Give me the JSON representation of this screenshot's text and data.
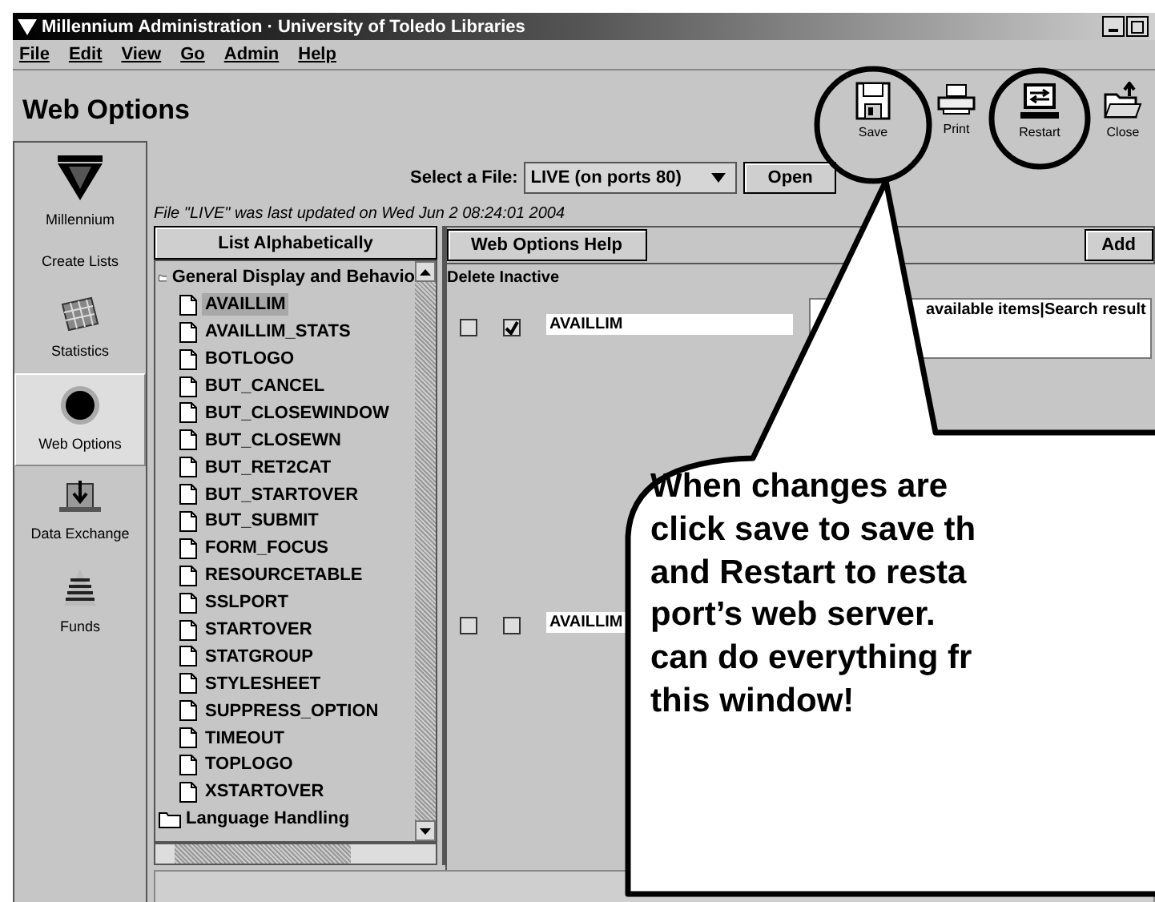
{
  "window": {
    "title": "Millennium Administration · University of Toledo Libraries"
  },
  "menu": [
    "File",
    "Edit",
    "View",
    "Go",
    "Admin",
    "Help"
  ],
  "page_title": "Web Options",
  "toolbar": [
    {
      "kind": "save",
      "label": "Save"
    },
    {
      "kind": "print",
      "label": "Print"
    },
    {
      "kind": "restart",
      "label": "Restart"
    },
    {
      "kind": "close",
      "label": "Close"
    }
  ],
  "sidebar": [
    {
      "kind": "logo",
      "label": "Millennium",
      "selected": false
    },
    {
      "kind": "none",
      "label": "Create Lists",
      "selected": false
    },
    {
      "kind": "statistics",
      "label": "Statistics",
      "selected": false
    },
    {
      "kind": "web_options",
      "label": "Web Options",
      "selected": true
    },
    {
      "kind": "data_exchange",
      "label": "Data Exchange",
      "selected": false
    },
    {
      "kind": "funds",
      "label": "Funds",
      "selected": false
    }
  ],
  "file_select": {
    "label": "Select a File:",
    "value": "LIVE (on ports 80)",
    "button": "Open"
  },
  "info": "File \"LIVE\" was last updated on Wed Jun  2 08:24:01 2004",
  "list_button": "List Alphabetically",
  "tree": [
    {
      "label": "General Display and Behavio",
      "children": [
        {
          "label": "AVAILLIM",
          "selected": true
        },
        {
          "label": "AVAILLIM_STATS",
          "selected": false
        },
        {
          "label": "BOTLOGO",
          "selected": false
        },
        {
          "label": "BUT_CANCEL",
          "selected": false
        },
        {
          "label": "BUT_CLOSEWINDOW",
          "selected": false
        },
        {
          "label": "BUT_CLOSEWN",
          "selected": false
        },
        {
          "label": "BUT_RET2CAT",
          "selected": false
        },
        {
          "label": "BUT_STARTOVER",
          "selected": false
        },
        {
          "label": "BUT_SUBMIT",
          "selected": false
        },
        {
          "label": "FORM_FOCUS",
          "selected": false
        },
        {
          "label": "RESOURCETABLE",
          "selected": false
        },
        {
          "label": "SSLPORT",
          "selected": false
        },
        {
          "label": "STARTOVER",
          "selected": false
        },
        {
          "label": "STATGROUP",
          "selected": false
        },
        {
          "label": "STYLESHEET",
          "selected": false
        },
        {
          "label": "SUPPRESS_OPTION",
          "selected": false
        },
        {
          "label": "TIMEOUT",
          "selected": false
        },
        {
          "label": "TOPLOGO",
          "selected": false
        },
        {
          "label": "XSTARTOVER",
          "selected": false
        }
      ]
    },
    {
      "label": "Language Handling"
    }
  ],
  "help_button": "Web Options Help",
  "add_button": "Add",
  "columns_label": "Delete Inactive",
  "rows": [
    {
      "delete_checked": false,
      "inactive_checked": true,
      "name": "AVAILLIM",
      "value": "available items|Search result"
    },
    {
      "delete_checked": false,
      "inactive_checked": false,
      "name": "AVAILLIM"
    }
  ],
  "callout": {
    "text": "When changes are\nclick save to save th\nand Restart to resta\nport’s web server.\ncan do everything fr\nthis window!"
  }
}
